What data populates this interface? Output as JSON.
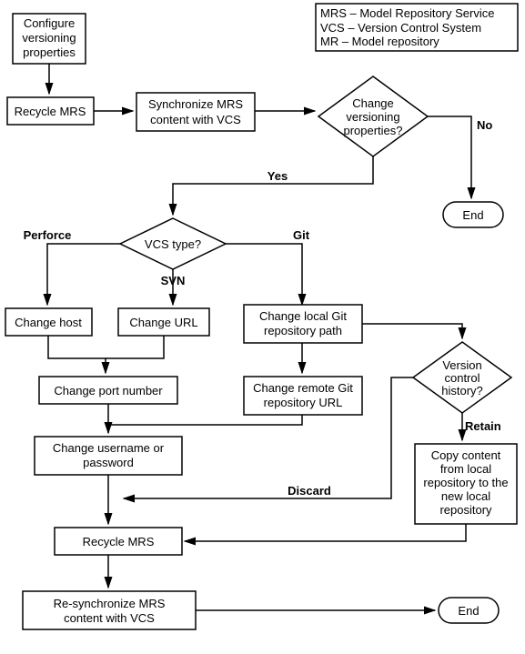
{
  "legend": {
    "l1": "MRS – Model Repository Service",
    "l2": "VCS – Version Control System",
    "l3": "MR – Model repository"
  },
  "nodes": {
    "configure": {
      "line1": "Configure",
      "line2": "versioning",
      "line3": "properties"
    },
    "recycle1": "Recycle MRS",
    "sync": {
      "line1": "Synchronize MRS",
      "line2": "content with VCS"
    },
    "q_change": {
      "line1": "Change",
      "line2": "versioning",
      "line3": "properties?"
    },
    "end1": "End",
    "q_vcstype": "VCS type?",
    "change_host": "Change host",
    "change_url": "Change URL",
    "change_local_git": {
      "line1": "Change local Git",
      "line2": "repository path"
    },
    "q_history": {
      "line1": "Version",
      "line2": "control",
      "line3": "history?"
    },
    "change_port": "Change port number",
    "change_remote_git": {
      "line1": "Change remote Git",
      "line2": "repository URL"
    },
    "change_user": {
      "line1": "Change username or",
      "line2": "password"
    },
    "copy_content": {
      "line1": "Copy content",
      "line2": "from local",
      "line3": "repository to the",
      "line4": "new local",
      "line5": "repository"
    },
    "recycle2": "Recycle MRS",
    "resync": {
      "line1": "Re-synchronize MRS",
      "line2": "content with VCS"
    },
    "end2": "End"
  },
  "labels": {
    "no": "No",
    "yes": "Yes",
    "perforce": "Perforce",
    "svn": "SVN",
    "git": "Git",
    "retain": "Retain",
    "discard": "Discard"
  }
}
